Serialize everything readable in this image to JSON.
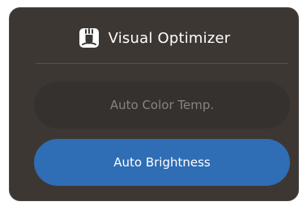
{
  "header": {
    "icon": "visual-optimizer-icon",
    "title": "Visual Optimizer"
  },
  "options": {
    "auto_color_temp": {
      "label": "Auto Color Temp.",
      "state": "unselected"
    },
    "auto_brightness": {
      "label": "Auto Brightness",
      "state": "selected"
    }
  },
  "colors": {
    "panel_background": "#3d3733",
    "selected_accent": "#2f6db5",
    "unselected_pill": "#35312e",
    "unselected_text": "#8a847f",
    "text": "#ffffff"
  }
}
